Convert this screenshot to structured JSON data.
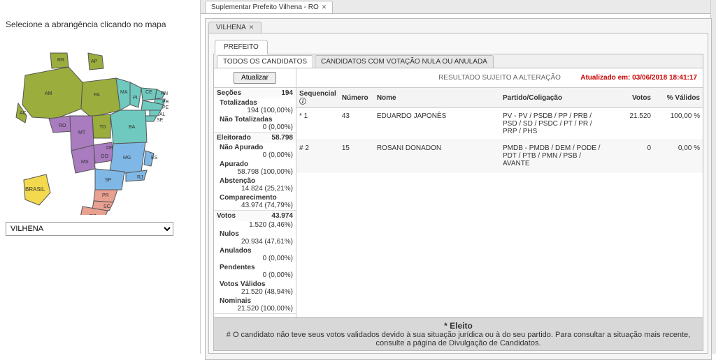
{
  "left": {
    "instruction": "Selecione a abrangência clicando no mapa",
    "select_value": "VILHENA",
    "brasil_label": "BRASIL",
    "states": [
      "RR",
      "AP",
      "AM",
      "PA",
      "MA",
      "CE",
      "RN",
      "PB",
      "PE",
      "PI",
      "AL",
      "SE",
      "BA",
      "TO",
      "AC",
      "RO",
      "MT",
      "DF",
      "GO",
      "MG",
      "ES",
      "MS",
      "SP",
      "RJ",
      "PR",
      "SC",
      "RS"
    ]
  },
  "topTab": {
    "label": "Suplementar Prefeito Vilhena - RO"
  },
  "subTab": {
    "label": "VILHENA"
  },
  "officeTab": {
    "label": "PREFEITO"
  },
  "candTabs": {
    "all": "TODOS OS CANDIDATOS",
    "null": "CANDIDATOS COM VOTAÇÃO NULA OU ANULADA"
  },
  "updateBtn": "Atualizar",
  "resultTitle": "RESULTADO SUJEITO A ALTERAÇÃO",
  "updatedLabel": "Atualizado em: 03/06/2018 18:41:17",
  "stats": {
    "secoes": {
      "label": "Seções",
      "value": "194"
    },
    "totalizadas": {
      "label": "Totalizadas",
      "value": "194 (100,00%)"
    },
    "naoTotalizadas": {
      "label": "Não Totalizadas",
      "value": "0 (0,00%)"
    },
    "eleitorado": {
      "label": "Eleitorado",
      "value": "58.798"
    },
    "naoApurado": {
      "label": "Não Apurado",
      "value": "0 (0,00%)"
    },
    "apurado": {
      "label": "Apurado",
      "value": "58.798 (100,00%)"
    },
    "abstencao": {
      "label": "Abstenção",
      "value": "14.824 (25,21%)"
    },
    "comparecimento": {
      "label": "Comparecimento",
      "value": "43.974 (74,79%)"
    },
    "votos": {
      "label": "Votos",
      "value": "43.974"
    },
    "brancos": {
      "value": "1.520 (3,46%)"
    },
    "nulos": {
      "label": "Nulos",
      "value": "20.934 (47,61%)"
    },
    "anulados": {
      "label": "Anulados",
      "value": "0 (0,00%)"
    },
    "pendentes": {
      "label": "Pendentes",
      "value": "0 (0,00%)"
    },
    "validos": {
      "label": "Votos Válidos",
      "value": "21.520 (48,94%)"
    },
    "nominais": {
      "label": "Nominais",
      "value": "21.520 (100,00%)"
    }
  },
  "tableHead": {
    "seq": "Sequencial",
    "num": "Número",
    "nome": "Nome",
    "partido": "Partido/Coligação",
    "votos": "Votos",
    "pct": "% Válidos"
  },
  "candidates": [
    {
      "seq": "* 1",
      "num": "43",
      "nome": "EDUARDO JAPONÊS",
      "coligacao": "PV - PV / PSDB / PP / PRB / PSD / SD / PSDC / PT / PR / PRP / PHS",
      "votos": "21.520",
      "pct": "100,00 %"
    },
    {
      "seq": "# 2",
      "num": "15",
      "nome": "ROSANI DONADON",
      "coligacao": "PMDB - PMDB / DEM / PODE / PDT / PTB / PMN / PSB / AVANTE",
      "votos": "0",
      "pct": "0,00 %"
    }
  ],
  "footer": {
    "title": "* Eleito",
    "note": "# O candidato não teve seus votos validados devido à sua situação jurídica ou à do seu partido. Para consultar a situação mais recente, consulte a página de Divulgação de Candidatos."
  }
}
